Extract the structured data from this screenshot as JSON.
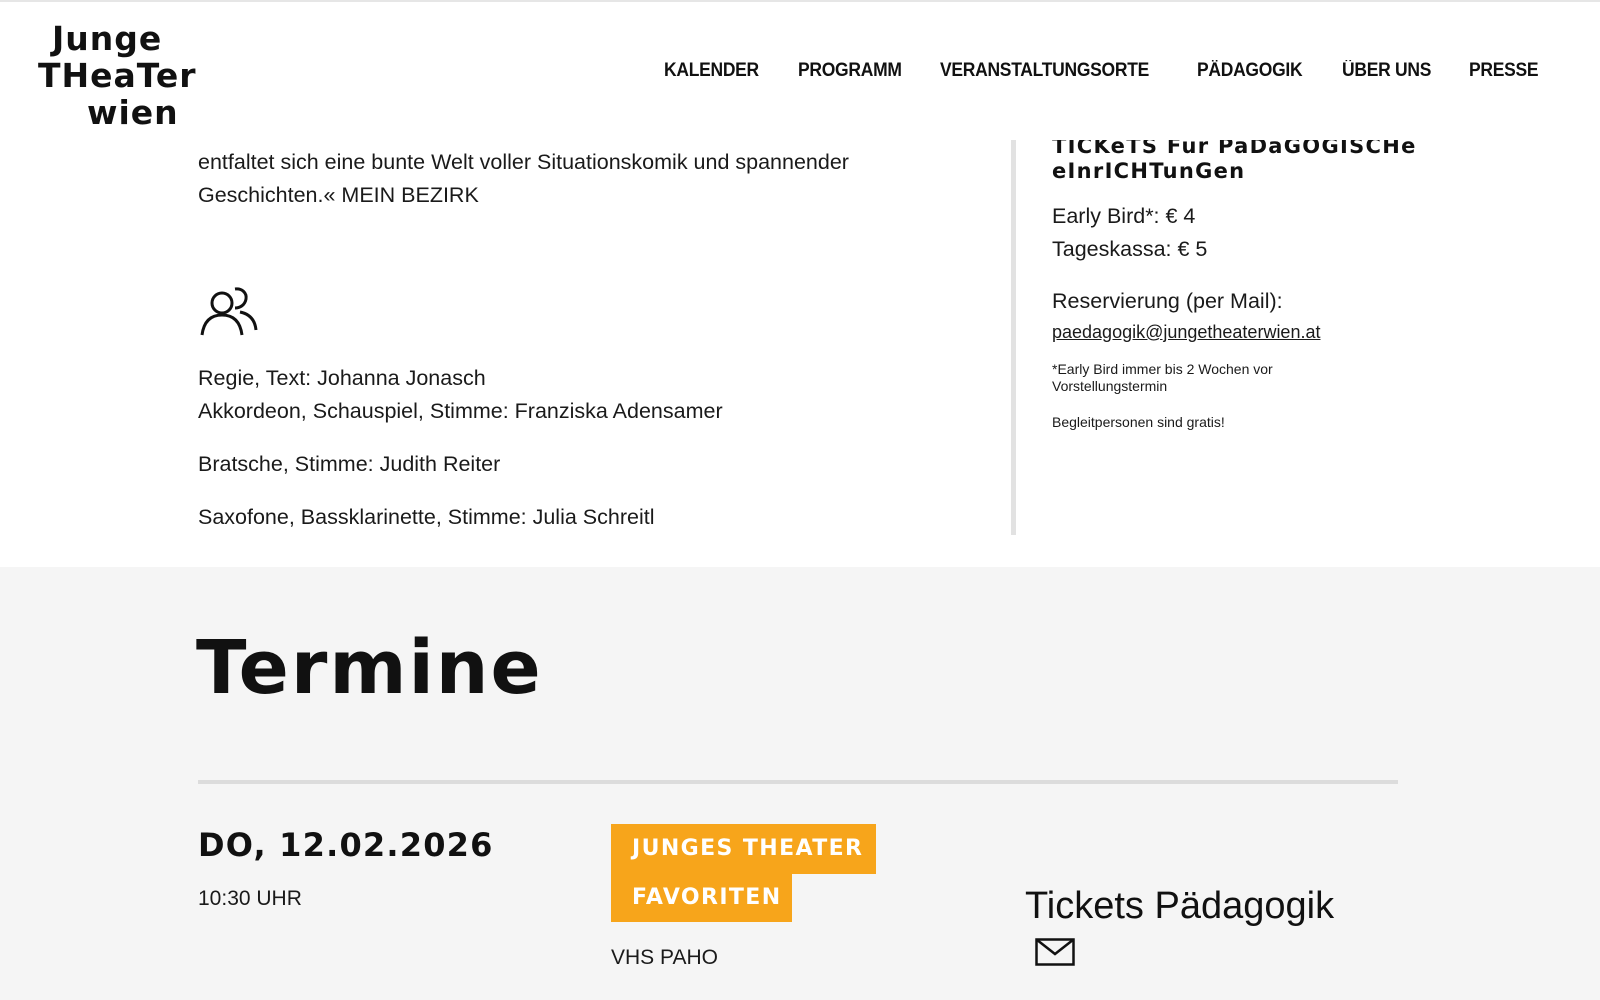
{
  "logo": {
    "line1": "Junge",
    "line2": "THeaTer",
    "line3": "wien"
  },
  "nav": [
    "KALENDER",
    "PROGRAMM",
    "VERANSTALTUNGSORTE",
    "PÄDAGOGIK",
    "ÜBER UNS",
    "PRESSE"
  ],
  "lead": {
    "line1": "entfaltet sich eine bunte Welt voller Situationskomik und spannender",
    "line2": "Geschichten.« MEIN BEZIRK"
  },
  "credits": {
    "icon": "people-icon",
    "lines": [
      "Regie, Text: Johanna Jonasch",
      "Akkordeon, Schauspiel, Stimme: Franziska Adensamer",
      "Bratsche, Stimme: Judith Reiter",
      "Saxofone, Bassklarinette, Stimme: Julia Schreitl"
    ]
  },
  "sidebar": {
    "heading_line1": "TICKeTS Für PäDaGOGISCHe",
    "heading_line2": "eInrICHTunGen",
    "price1": "Early Bird*: € 4",
    "price2": "Tageskassa: € 5",
    "reserve_label": "Reservierung (per Mail):",
    "email": "paedagogik@jungetheaterwien.at",
    "note": "*Early Bird immer bis 2 Wochen vor Vorstellungstermin",
    "note2": "Begleitpersonen sind gratis!"
  },
  "termine": {
    "title": "Termine",
    "date": "DO, 12.02.2026",
    "time": "10:30 UHR",
    "tag_line1": "JUNGES THEATER",
    "tag_line2": "FAVORITEN",
    "venue": "VHS PAHO",
    "tickets_label": "Tickets Pädagogik",
    "mail_icon": "envelope-icon"
  },
  "colors": {
    "accent": "#f7a51b",
    "section_bg": "#f5f5f5",
    "divider": "#e2e2e2"
  }
}
